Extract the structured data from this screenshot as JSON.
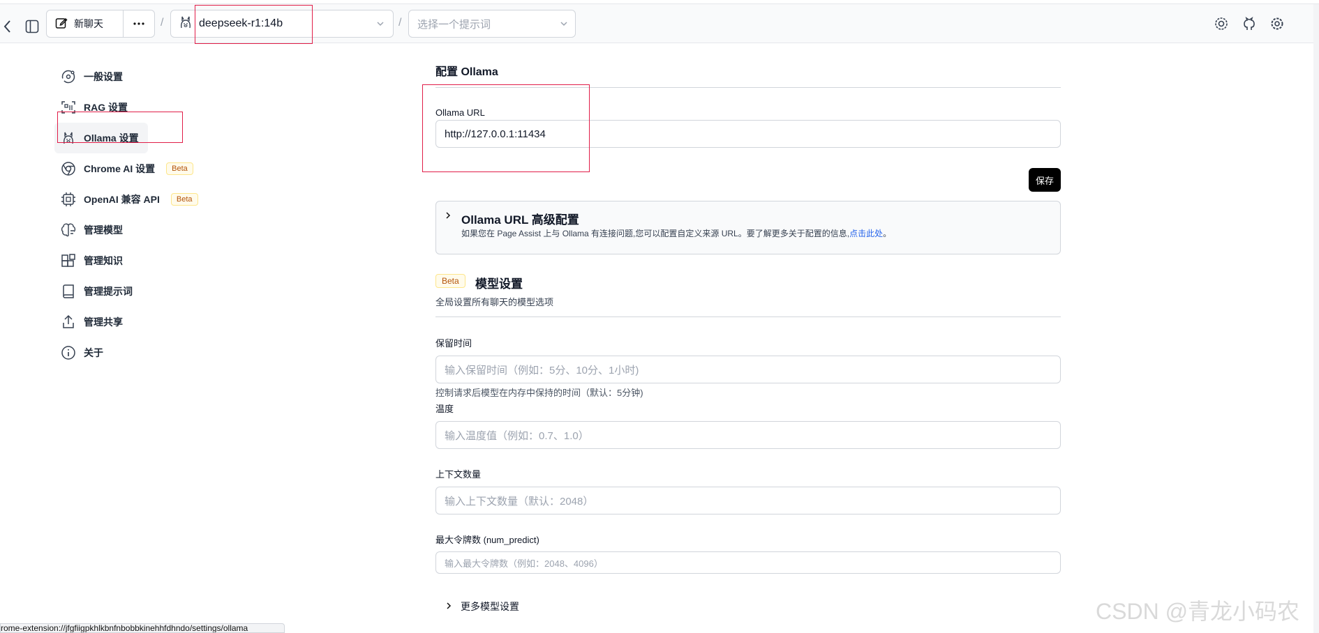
{
  "header": {
    "new_chat_label": "新聊天",
    "model_value": "deepseek-r1:14b",
    "prompt_placeholder": "选择一个提示词",
    "separator": "/"
  },
  "nav": {
    "items": [
      {
        "label": "一般设置",
        "icon": "orbit-icon"
      },
      {
        "label": "RAG 设置",
        "icon": "scan-icon"
      },
      {
        "label": "Ollama 设置",
        "icon": "ollama-llama-icon"
      },
      {
        "label": "Chrome AI 设置",
        "icon": "chrome-icon",
        "badge": "Beta"
      },
      {
        "label": "OpenAI 兼容 API",
        "icon": "cpu-icon",
        "badge": "Beta"
      },
      {
        "label": "管理模型",
        "icon": "brain-icon"
      },
      {
        "label": "管理知识",
        "icon": "blocks-icon"
      },
      {
        "label": "管理提示词",
        "icon": "book-icon"
      },
      {
        "label": "管理共享",
        "icon": "share-icon"
      },
      {
        "label": "关于",
        "icon": "info-icon"
      }
    ],
    "active_item": "Ollama 设置"
  },
  "ollama": {
    "section_title": "配置 Ollama",
    "url_label": "Ollama URL",
    "url_value": "http://127.0.0.1:11434",
    "save_label": "保存",
    "advanced_title": "Ollama URL 高级配置",
    "advanced_desc": "如果您在 Page Assist 上与 Ollama 有连接问题,您可以配置自定义来源 URL。要了解更多关于配置的信息,",
    "advanced_link": "点击此处",
    "advanced_end": "。"
  },
  "model_settings": {
    "badge": "Beta",
    "title": "模型设置",
    "subtitle": "全局设置所有聊天的模型选项",
    "keep_alive_label": "保留时间",
    "keep_alive_placeholder": "输入保留时间（例如：5分、10分、1小时)",
    "keep_alive_help": "控制请求后模型在内存中保持的时间（默认：5分钟)",
    "temperature_label": "温度",
    "temperature_placeholder": "输入温度值（例如：0.7、1.0）",
    "context_label": "上下文数量",
    "context_placeholder": "输入上下文数量（默认：2048）",
    "max_tokens_label": "最大令牌数 (num_predict)",
    "max_tokens_placeholder": "输入最大令牌数（例如：2048、4096）",
    "more_settings_label": "更多模型设置"
  },
  "status_bar": {
    "url": "rome-extension://jfgfiigpkhlkbnfnbobbkinehhfdhndo/settings/ollama"
  },
  "watermark": "CSDN @青龙小码农",
  "colors": {
    "annotation_red": "#e11d48",
    "save_button_bg": "#000000",
    "link": "#2563eb",
    "beta_text": "#b45309"
  }
}
